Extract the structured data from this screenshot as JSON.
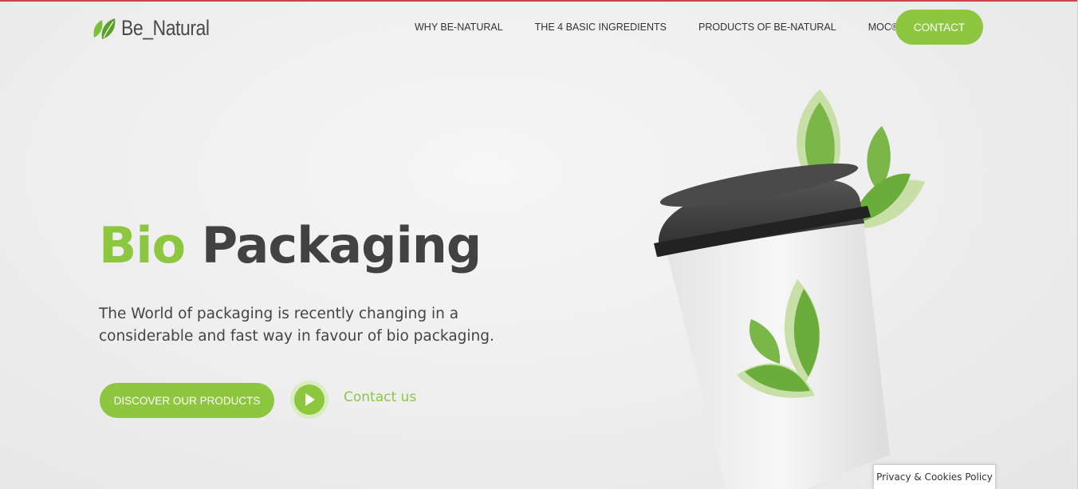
{
  "brand": {
    "name": "Be_Natural",
    "accent_color": "#8dc63f",
    "logo_icon": "leaf-logo-icon"
  },
  "nav": {
    "items": [
      {
        "label": "WHY BE-NATURAL"
      },
      {
        "label": "THE 4 BASIC INGREDIENTS"
      },
      {
        "label": "PRODUCTS OF BE-NATURAL"
      },
      {
        "label": "MOC®"
      }
    ],
    "contact_label": "CONTACT"
  },
  "hero": {
    "title_highlight": "Bio",
    "title_rest": "Packaging",
    "description": "The World of packaging is recently changing in a considerable and fast way in favour of bio packaging.",
    "primary_button": "DISCOVER OUR PRODUCTS",
    "play_icon": "play-icon",
    "contact_link": "Contact us"
  },
  "footer": {
    "cookies_label": "Privacy & Cookies Policy"
  }
}
